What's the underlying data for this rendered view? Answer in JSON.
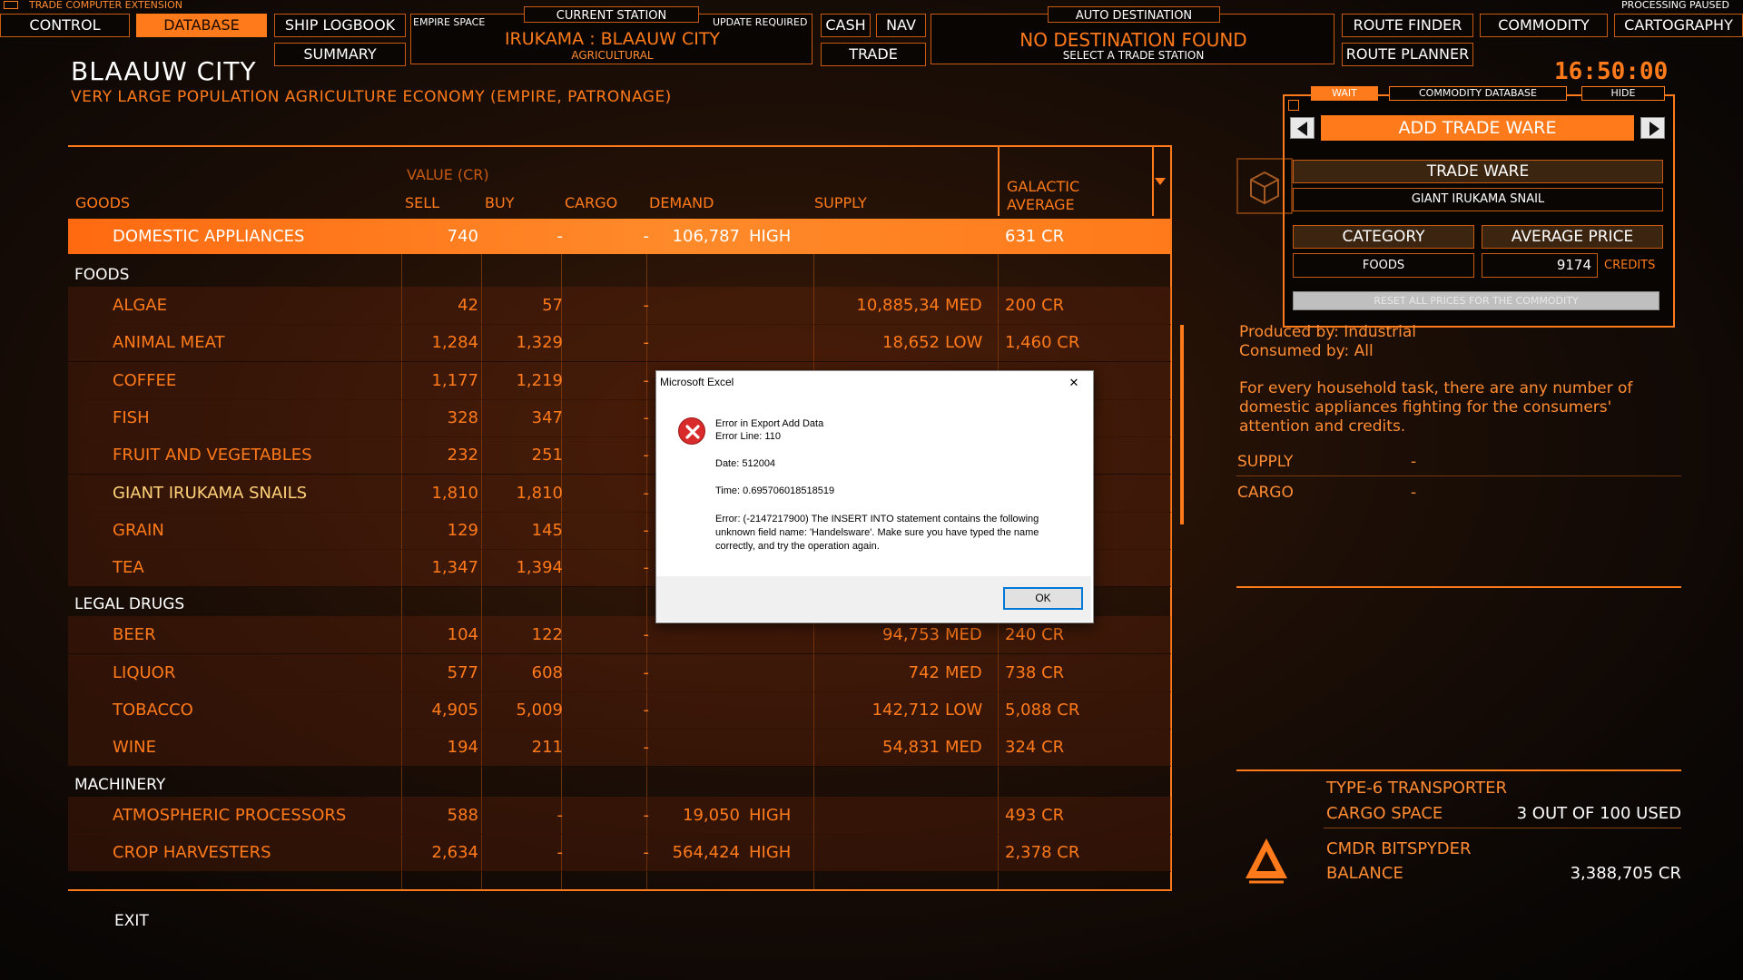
{
  "hud": {
    "extension_label": "TRADE COMPUTER EXTENSION",
    "processing_label": "PROCESSING PAUSED",
    "nav_buttons": {
      "control": "CONTROL",
      "database": "DATABASE",
      "ship_logbook": "SHIP LOGBOOK",
      "summary": "SUMMARY",
      "cash": "CASH",
      "nav": "NAV",
      "trade": "TRADE",
      "route_finder": "ROUTE FINDER",
      "commodity": "COMMODITY",
      "cartography": "CARTOGRAPHY",
      "route_planner": "ROUTE PLANNER"
    },
    "station_panel": {
      "empire_space": "EMPIRE SPACE",
      "current_station_label": "CURRENT STATION",
      "update_required": "UPDATE REQUIRED",
      "station_name": "IRUKAMA : BLAAUW CITY",
      "station_type": "AGRICULTURAL"
    },
    "destination_panel": {
      "label": "AUTO DESTINATION",
      "status": "NO DESTINATION FOUND",
      "hint": "SELECT A TRADE STATION"
    },
    "clock": "16:50:00"
  },
  "station": {
    "title": "BLAAUW CITY",
    "subtitle": "VERY LARGE POPULATION AGRICULTURE ECONOMY (EMPIRE, PATRONAGE)"
  },
  "table": {
    "headers": {
      "goods": "GOODS",
      "value": "VALUE (CR)",
      "sell": "SELL",
      "buy": "BUY",
      "cargo": "CARGO",
      "demand": "DEMAND",
      "supply": "SUPPLY",
      "galactic_1": "GALACTIC",
      "galactic_2": "AVERAGE"
    },
    "selected_row": {
      "name": "DOMESTIC APPLIANCES",
      "sell": "740",
      "buy": "-",
      "cargo": "-",
      "demand": "106,787",
      "demand_level": "HIGH",
      "supply": "",
      "supply_level": "",
      "avg": "631 CR"
    },
    "categories": [
      {
        "name": "FOODS",
        "rows": [
          {
            "name": "ALGAE",
            "sell": "42",
            "buy": "57",
            "cargo": "-",
            "demand": "",
            "demand_level": "",
            "supply": "10,885,34",
            "supply_level": "MED",
            "avg": "200 CR"
          },
          {
            "name": "ANIMAL MEAT",
            "sell": "1,284",
            "buy": "1,329",
            "cargo": "-",
            "demand": "",
            "demand_level": "",
            "supply": "18,652",
            "supply_level": "LOW",
            "avg": "1,460 CR"
          },
          {
            "name": "COFFEE",
            "sell": "1,177",
            "buy": "1,219",
            "cargo": "-",
            "demand": "",
            "demand_level": "",
            "supply": "",
            "supply_level": "",
            "avg": ""
          },
          {
            "name": "FISH",
            "sell": "328",
            "buy": "347",
            "cargo": "-",
            "demand": "",
            "demand_level": "",
            "supply": "",
            "supply_level": "",
            "avg": ""
          },
          {
            "name": "FRUIT AND VEGETABLES",
            "sell": "232",
            "buy": "251",
            "cargo": "-",
            "demand": "",
            "demand_level": "",
            "supply": "",
            "supply_level": "",
            "avg": ""
          },
          {
            "name": "GIANT IRUKAMA SNAILS",
            "sell": "1,810",
            "buy": "1,810",
            "cargo": "-",
            "demand": "",
            "demand_level": "",
            "supply": "",
            "supply_level": "",
            "avg": ""
          },
          {
            "name": "GRAIN",
            "sell": "129",
            "buy": "145",
            "cargo": "-",
            "demand": "",
            "demand_level": "",
            "supply": "",
            "supply_level": "",
            "avg": ""
          },
          {
            "name": "TEA",
            "sell": "1,347",
            "buy": "1,394",
            "cargo": "-",
            "demand": "",
            "demand_level": "",
            "supply": "",
            "supply_level": "",
            "avg": ""
          }
        ]
      },
      {
        "name": "LEGAL DRUGS",
        "rows": [
          {
            "name": "BEER",
            "sell": "104",
            "buy": "122",
            "cargo": "-",
            "demand": "",
            "demand_level": "",
            "supply": "94,753",
            "supply_level": "MED",
            "avg": "240 CR"
          },
          {
            "name": "LIQUOR",
            "sell": "577",
            "buy": "608",
            "cargo": "-",
            "demand": "",
            "demand_level": "",
            "supply": "742",
            "supply_level": "MED",
            "avg": "738 CR"
          },
          {
            "name": "TOBACCO",
            "sell": "4,905",
            "buy": "5,009",
            "cargo": "-",
            "demand": "",
            "demand_level": "",
            "supply": "142,712",
            "supply_level": "LOW",
            "avg": "5,088 CR"
          },
          {
            "name": "WINE",
            "sell": "194",
            "buy": "211",
            "cargo": "-",
            "demand": "",
            "demand_level": "",
            "supply": "54,831",
            "supply_level": "MED",
            "avg": "324 CR"
          }
        ]
      },
      {
        "name": "MACHINERY",
        "rows": [
          {
            "name": "ATMOSPHERIC PROCESSORS",
            "sell": "588",
            "buy": "-",
            "cargo": "-",
            "demand": "19,050",
            "demand_level": "HIGH",
            "supply": "",
            "supply_level": "",
            "avg": "493 CR"
          },
          {
            "name": "CROP HARVESTERS",
            "sell": "2,634",
            "buy": "-",
            "cargo": "-",
            "demand": "564,424",
            "demand_level": "HIGH",
            "supply": "",
            "supply_level": "",
            "avg": "2,378 CR"
          }
        ]
      }
    ],
    "exit_label": "EXIT"
  },
  "right_panel": {
    "wait_tab": "WAIT",
    "commodity_db_tab": "COMMODITY DATABASE",
    "hide_tab": "HIDE",
    "add_trade_ware": "ADD TRADE WARE",
    "trade_ware_label": "TRADE WARE",
    "trade_ware_value": "GIANT IRUKAMA SNAIL",
    "category_label": "CATEGORY",
    "category_value": "FOODS",
    "avg_price_label": "AVERAGE PRICE",
    "avg_price_value": "9174",
    "credits_label": "CREDITS",
    "reset_button": "RESET ALL PRICES FOR THE COMMODITY",
    "produced_by": "Produced by: Industrial",
    "consumed_by": "Consumed by: All",
    "description": "For every household task, there are any number of domestic appliances fighting for the consumers' attention and credits.",
    "supply_label": "SUPPLY",
    "supply_value": "-",
    "cargo_label": "CARGO",
    "cargo_value": "-",
    "ship_name": "TYPE-6 TRANSPORTER",
    "cargo_space_label": "CARGO SPACE",
    "cargo_space_value": "3 OUT OF 100 USED",
    "cmdr_name": "CMDR BITSPYDER",
    "balance_label": "BALANCE",
    "balance_value": "3,388,705 CR"
  },
  "dialog": {
    "title": "Microsoft Excel",
    "line1": "Error in Export Add Data",
    "line2": "Error Line: 110",
    "date": "Date: 512004",
    "time": "Time: 0.695706018518519",
    "error": "Error: (-2147217900) The INSERT INTO statement contains the following unknown field name: 'Handelsware'. Make sure you have typed the name correctly, and try the operation again.",
    "ok_label": "OK",
    "close_glyph": "✕"
  },
  "colors": {
    "accent": "#ff7a1a",
    "background": "#0b0705",
    "text_white": "#ffffff"
  }
}
